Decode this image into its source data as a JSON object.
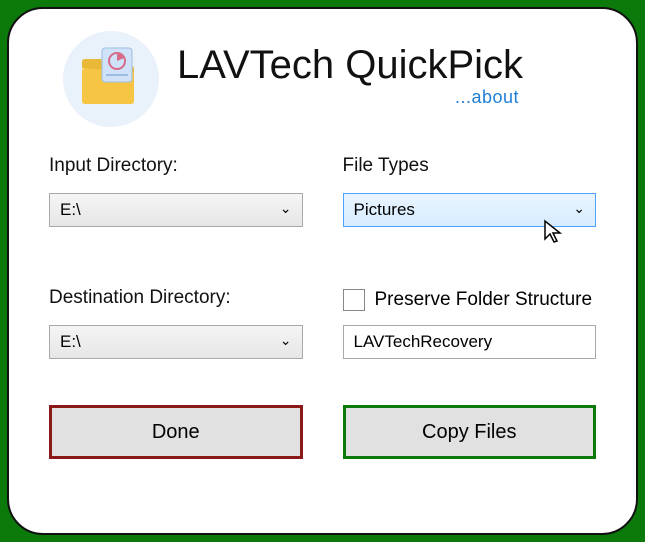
{
  "header": {
    "title": "LAVTech QuickPick",
    "about_label": "...about"
  },
  "input_dir": {
    "label": "Input Directory:",
    "value": "E:\\"
  },
  "file_types": {
    "label": "File Types",
    "value": "Pictures"
  },
  "dest_dir": {
    "label": "Destination Directory:",
    "value": "E:\\"
  },
  "preserve": {
    "label": "Preserve Folder Structure",
    "checked": false
  },
  "folder_name": {
    "value": "LAVTechRecovery"
  },
  "buttons": {
    "done": "Done",
    "copy": "Copy Files"
  }
}
